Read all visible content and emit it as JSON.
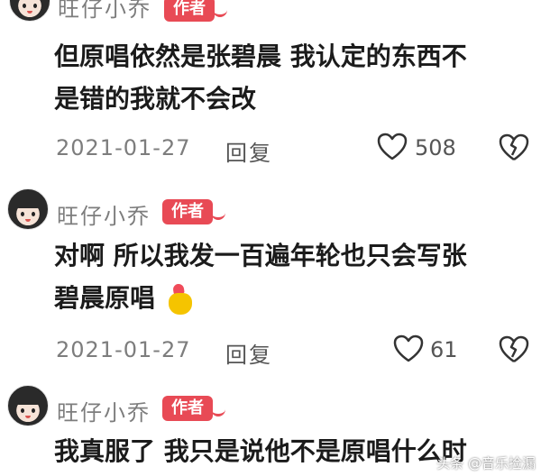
{
  "comments": [
    {
      "username": "旺仔小乔",
      "badge": "作者",
      "text_lines": [
        "但原唱依然是张碧晨 我认定的东西不",
        "是错的我就不会改"
      ],
      "date": "2021-01-27",
      "reply_label": "回复",
      "likes": "508"
    },
    {
      "username": "旺仔小乔",
      "badge": "作者",
      "text_lines": [
        "对啊 所以我发一百遍年轮也只会写张",
        "碧晨原唱"
      ],
      "date": "2021-01-27",
      "reply_label": "回复",
      "likes": "61"
    },
    {
      "username": "旺仔小乔",
      "badge": "作者",
      "text_lines": [
        "我真服了 我只是说他不是原唱什么时"
      ]
    }
  ],
  "watermark": "头条 @音乐捡漏",
  "colors": {
    "badge": "#e84a55",
    "meta_text": "#7d7d7d"
  }
}
